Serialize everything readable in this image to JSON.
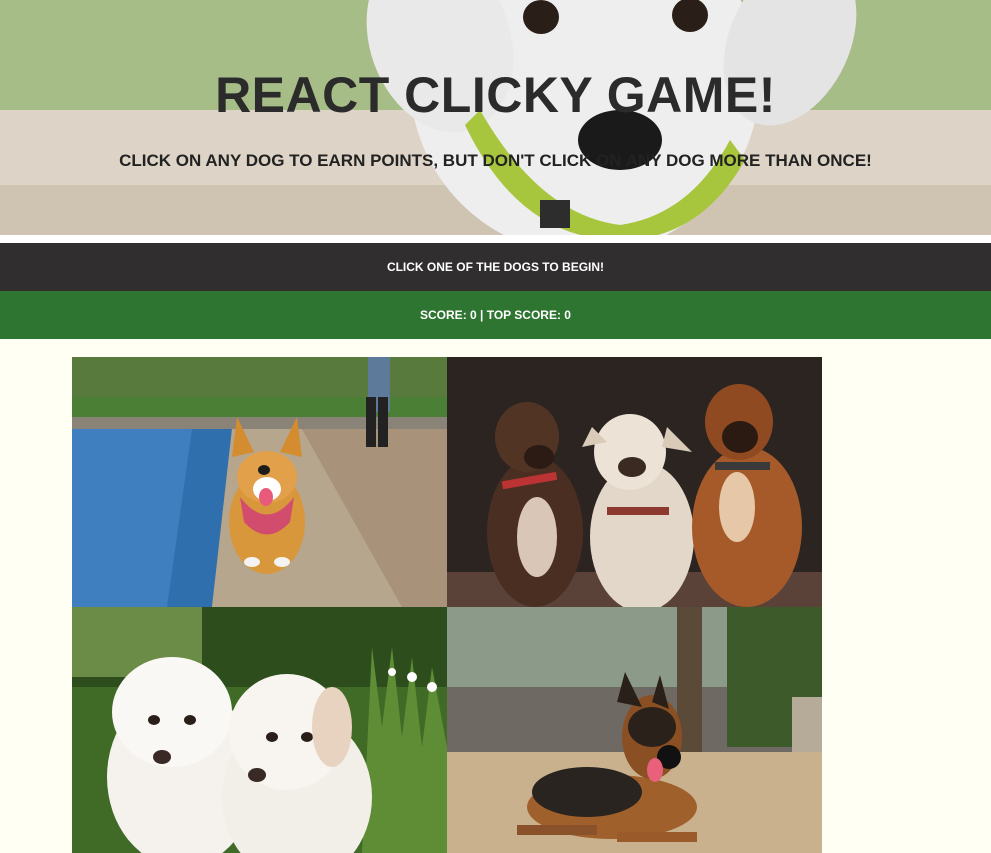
{
  "header": {
    "title": "REACT CLICKY GAME!",
    "subtitle": "CLICK ON ANY DOG TO EARN POINTS, BUT DON'T CLICK ON ANY DOG MORE THAN ONCE!"
  },
  "status": {
    "message": "CLICK ONE OF THE DOGS TO BEGIN!"
  },
  "score": {
    "label": "SCORE: 0 | TOP SCORE: 0",
    "score": 0,
    "top_score": 0
  },
  "dogs": [
    {
      "name": "corgi"
    },
    {
      "name": "three-boxers"
    },
    {
      "name": "two-white-puppies"
    },
    {
      "name": "german-shepherd"
    }
  ],
  "colors": {
    "page_background": "#fffff4",
    "status_bar": "#302e2e",
    "score_bar": "#2e7531",
    "title_text": "#2b2b2b"
  }
}
